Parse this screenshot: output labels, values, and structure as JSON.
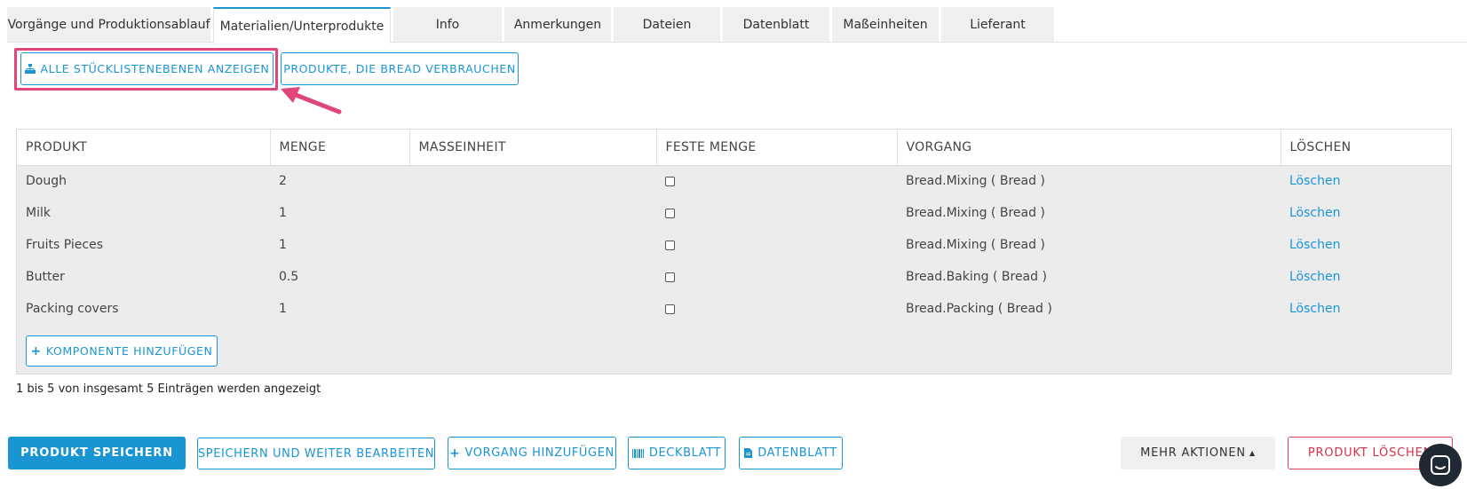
{
  "tabs": [
    {
      "label": "Vorgänge und Produktionsablauf",
      "active": false
    },
    {
      "label": "Materialien/Unterprodukte",
      "active": true
    },
    {
      "label": "Info",
      "active": false
    },
    {
      "label": "Anmerkungen",
      "active": false
    },
    {
      "label": "Dateien",
      "active": false
    },
    {
      "label": "Datenblatt",
      "active": false
    },
    {
      "label": "Maßeinheiten",
      "active": false
    },
    {
      "label": "Lieferant",
      "active": false
    }
  ],
  "toolbar": {
    "show_bom_levels": "ALLE STÜCKLISTENEBENEN ANZEIGEN",
    "products_consuming": "PRODUKTE, DIE BREAD VERBRAUCHEN"
  },
  "table": {
    "headers": [
      "PRODUKT",
      "MENGE",
      "MASSEINHEIT",
      "FESTE MENGE",
      "VORGANG",
      "LÖSCHEN"
    ],
    "rows": [
      {
        "produkt": "Dough",
        "menge": "2",
        "masseinheit": "",
        "feste_menge": false,
        "vorgang": "Bread.Mixing ( Bread )",
        "loeschen": "Löschen"
      },
      {
        "produkt": "Milk",
        "menge": "1",
        "masseinheit": "",
        "feste_menge": false,
        "vorgang": "Bread.Mixing ( Bread )",
        "loeschen": "Löschen"
      },
      {
        "produkt": "Fruits Pieces",
        "menge": "1",
        "masseinheit": "",
        "feste_menge": false,
        "vorgang": "Bread.Mixing ( Bread )",
        "loeschen": "Löschen"
      },
      {
        "produkt": "Butter",
        "menge": "0.5",
        "masseinheit": "",
        "feste_menge": false,
        "vorgang": "Bread.Baking ( Bread )",
        "loeschen": "Löschen"
      },
      {
        "produkt": "Packing covers",
        "menge": "1",
        "masseinheit": "",
        "feste_menge": false,
        "vorgang": "Bread.Packing ( Bread )",
        "loeschen": "Löschen"
      }
    ],
    "add_component": "KOMPONENTE HINZUFÜGEN"
  },
  "info_text": "1 bis 5 von insgesamt 5 Einträgen werden angezeigt",
  "actions": {
    "save": "PRODUKT SPEICHERN",
    "save_continue": "SPEICHERN UND WEITER BEARBEITEN",
    "add_operation": "VORGANG HINZUFÜGEN",
    "cover_sheet": "DECKBLATT",
    "data_sheet": "DATENBLATT",
    "more_actions": "MEHR AKTIONEN",
    "delete_product": "PRODUKT LÖSCHEN"
  },
  "colors": {
    "accent": "#1a95d3",
    "highlight": "#e0457b",
    "danger": "#d9304a"
  }
}
